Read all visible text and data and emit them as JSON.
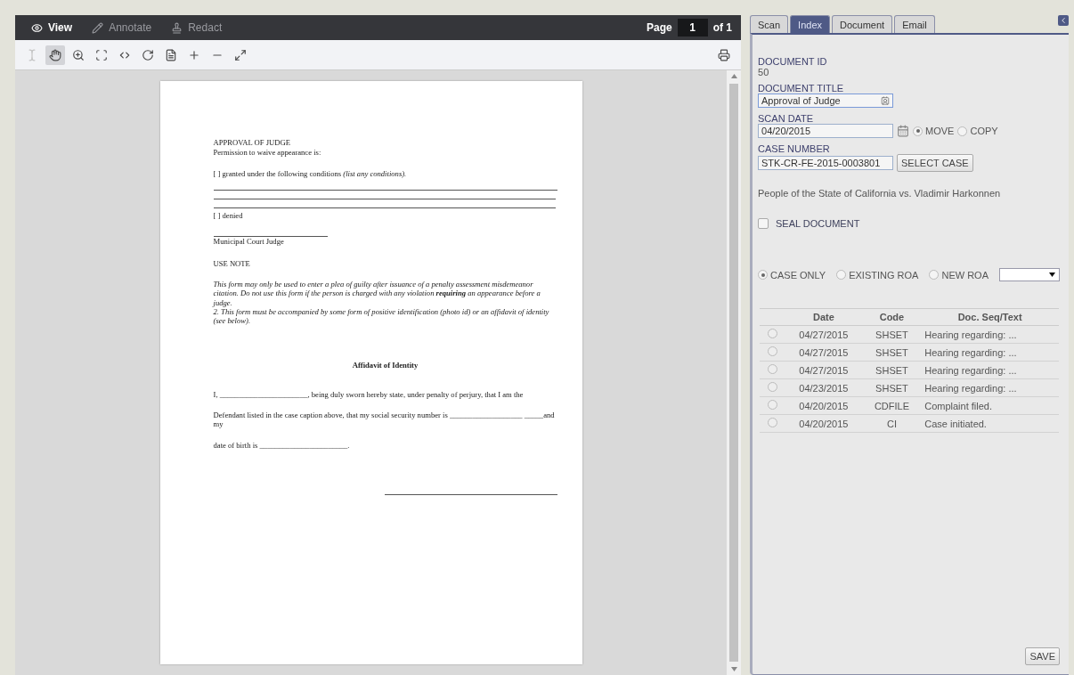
{
  "viewer": {
    "modes": [
      {
        "kind": "view",
        "label": "View",
        "selected": true
      },
      {
        "kind": "annotate",
        "label": "Annotate",
        "selected": false
      },
      {
        "kind": "redact",
        "label": "Redact",
        "selected": false
      }
    ],
    "page_label": "Page",
    "page_value": "1",
    "page_total": "of 1",
    "tools": [
      {
        "kind": "text-select",
        "selected": false,
        "disabled": true
      },
      {
        "kind": "pan",
        "selected": true,
        "disabled": false
      },
      {
        "kind": "zoom-box",
        "selected": false,
        "disabled": false
      },
      {
        "kind": "marquee",
        "selected": false,
        "disabled": false
      },
      {
        "kind": "fit-width",
        "selected": false,
        "disabled": false
      },
      {
        "kind": "rotate",
        "selected": false,
        "disabled": false
      },
      {
        "kind": "fit-page",
        "selected": false,
        "disabled": false
      },
      {
        "kind": "zoom-in",
        "selected": false,
        "disabled": false
      },
      {
        "kind": "zoom-out",
        "selected": false,
        "disabled": false
      },
      {
        "kind": "fullscreen",
        "selected": false,
        "disabled": false
      }
    ],
    "document": [
      {
        "kind": "text",
        "text": "APPROVAL OF JUDGE"
      },
      {
        "kind": "para",
        "text": "Permission to waive appearance is:"
      },
      {
        "kind": "para",
        "text": "[ ] granted under the following conditions *(list any conditions).*"
      },
      {
        "kind": "rules"
      },
      {
        "kind": "text",
        "text": "[ ] denied"
      },
      {
        "kind": "sign",
        "text": "Municipal Court Judge"
      },
      {
        "kind": "para",
        "text": "USE NOTE"
      },
      {
        "kind": "note",
        "text": "This form may only be used to enter a plea of guilty after issuance of a penalty assessment misdemeanor citation.  Do not use this form if the person is charged with any violation **requiring** an appearance before a judge."
      },
      {
        "kind": "italic",
        "text": "2.  This form must be accompanied by some form of positive identification (photo id) or an affidavit of identity (see below)."
      },
      {
        "kind": "heading",
        "text": "Affidavit of Identity"
      },
      {
        "kind": "para",
        "text": "I, _______________________, being duly sworn hereby state, under penalty of perjury, that I am the"
      },
      {
        "kind": "para",
        "text": "Defendant listed in the case caption above, that my social security number is ___________________ _____and my"
      },
      {
        "kind": "para",
        "text": "date of birth is _______________________."
      },
      {
        "kind": "signature"
      }
    ]
  },
  "panel": {
    "tabs": [
      {
        "label": "Scan",
        "selected": false
      },
      {
        "label": "Index",
        "selected": true
      },
      {
        "label": "Document",
        "selected": false
      },
      {
        "label": "Email",
        "selected": false
      }
    ],
    "document_id_label": "DOCUMENT ID",
    "document_id": "50",
    "document_title_label": "DOCUMENT TITLE",
    "document_title": "Approval of Judge",
    "scan_date_label": "SCAN DATE",
    "scan_date": "04/20/2015",
    "file_options": [
      {
        "label": "MOVE",
        "selected": true
      },
      {
        "label": "COPY",
        "selected": false
      }
    ],
    "case_number_label": "CASE NUMBER",
    "case_number": "STK-CR-FE-2015-0003801",
    "select_case": "SELECT CASE",
    "case_title": "People of the State of California vs. Vladimir Harkonnen",
    "seal": {
      "label": "SEAL DOCUMENT",
      "checked": false
    },
    "roa_options": [
      {
        "label": "CASE ONLY",
        "selected": true
      },
      {
        "label": "EXISTING ROA",
        "selected": false
      },
      {
        "label": "NEW ROA",
        "selected": false
      }
    ],
    "table": {
      "columns": [
        "Date",
        "Code",
        "Doc. Seq/Text"
      ],
      "rows": [
        {
          "selected": false,
          "cells": [
            "04/27/2015",
            "SHSET",
            "Hearing regarding: ..."
          ]
        },
        {
          "selected": false,
          "cells": [
            "04/27/2015",
            "SHSET",
            "Hearing regarding: ..."
          ]
        },
        {
          "selected": false,
          "cells": [
            "04/27/2015",
            "SHSET",
            "Hearing regarding: ..."
          ]
        },
        {
          "selected": false,
          "cells": [
            "04/23/2015",
            "SHSET",
            "Hearing regarding: ..."
          ]
        },
        {
          "selected": false,
          "cells": [
            "04/20/2015",
            "CDFILE",
            "Complaint filed."
          ]
        },
        {
          "selected": false,
          "cells": [
            "04/20/2015",
            "CI",
            "Case initiated."
          ]
        }
      ]
    },
    "save": "SAVE"
  }
}
